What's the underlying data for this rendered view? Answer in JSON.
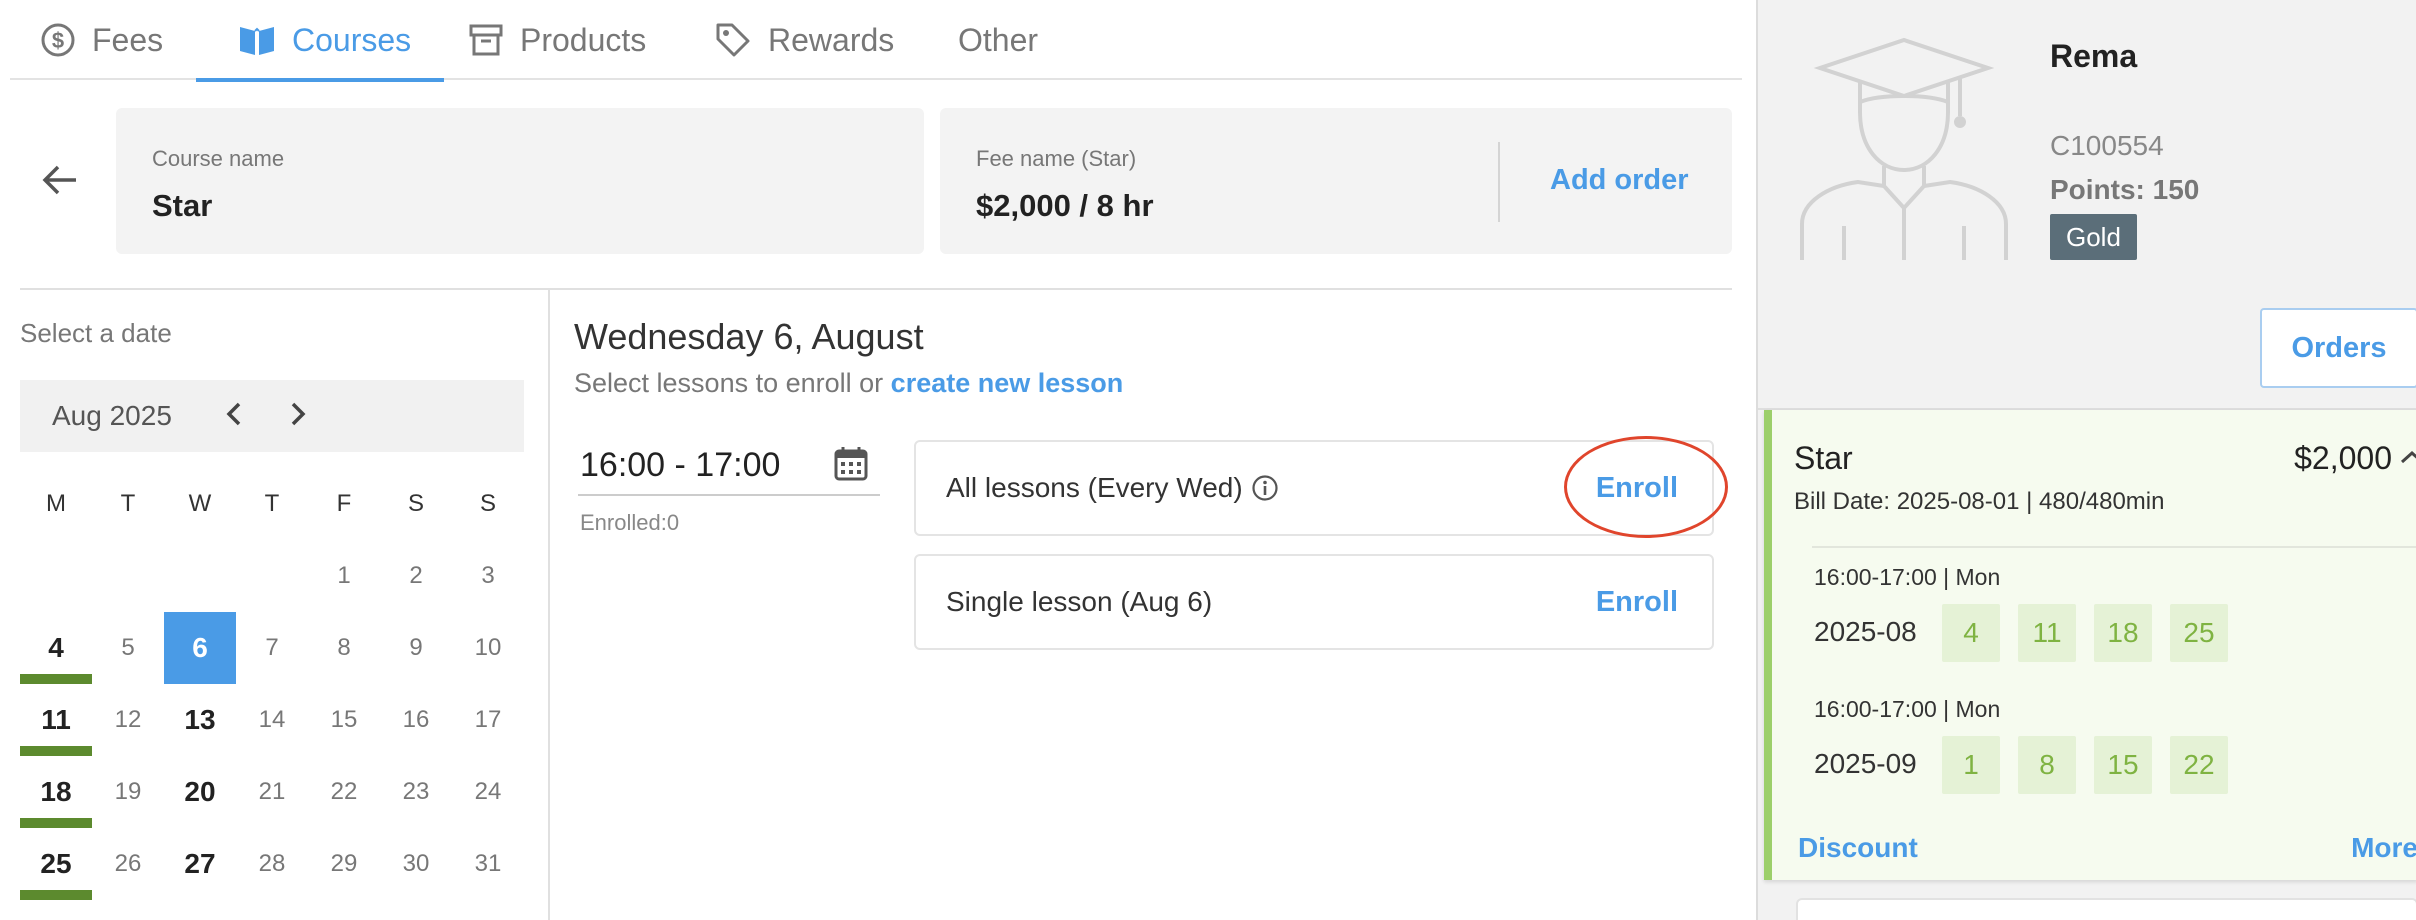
{
  "tabs": [
    {
      "label": "Fees",
      "icon": "dollar-circle-icon"
    },
    {
      "label": "Courses",
      "icon": "open-book-icon"
    },
    {
      "label": "Products",
      "icon": "archive-box-icon"
    },
    {
      "label": "Rewards",
      "icon": "tag-icon"
    },
    {
      "label": "Other",
      "icon": ""
    }
  ],
  "active_tab": "Courses",
  "accent_color": "#4a9be6",
  "course_card": {
    "label": "Course name",
    "value": "Star"
  },
  "fee_card": {
    "label": "Fee name (Star)",
    "value": "$2,000 / 8 hr",
    "action": "Add order"
  },
  "calendar": {
    "prompt": "Select a date",
    "month_label": "Aug 2025",
    "weekdays": [
      "M",
      "T",
      "W",
      "T",
      "F",
      "S",
      "S"
    ],
    "weeks": [
      [
        "",
        "",
        "",
        "1",
        "2",
        "3"
      ],
      [
        "4",
        "5",
        "6",
        "7",
        "8",
        "9",
        "10"
      ],
      [
        "11",
        "12",
        "13",
        "14",
        "15",
        "16",
        "17"
      ],
      [
        "18",
        "19",
        "20",
        "21",
        "22",
        "23",
        "24"
      ],
      [
        "25",
        "26",
        "27",
        "28",
        "29",
        "30",
        "31"
      ]
    ],
    "selected_day": "6"
  },
  "lessons": {
    "day_heading": "Wednesday 6, August",
    "subtitle_prefix": "Select lessons to enroll or",
    "create_link": "create new lesson",
    "time_range": "16:00 - 17:00",
    "enrolled": "Enrolled:0",
    "options": [
      {
        "name": "All lessons (Every Wed)",
        "action": "Enroll"
      },
      {
        "name": "Single lesson (Aug 6)",
        "action": "Enroll"
      }
    ]
  },
  "student": {
    "name": "Rema",
    "id": "C100554",
    "points": "Points: 150",
    "tier": "Gold",
    "tier_color": "#5b6e79",
    "orders_label": "Orders"
  },
  "order": {
    "course": "Star",
    "price": "$2,000",
    "bill": "Bill Date: 2025-08-01 | 480/480min",
    "schedules": [
      {
        "time": "16:00-17:00 | Mon",
        "month": "2025-08",
        "days": [
          "4",
          "11",
          "18",
          "25"
        ]
      },
      {
        "time": "16:00-17:00 | Mon",
        "month": "2025-09",
        "days": [
          "1",
          "8",
          "15",
          "22"
        ]
      }
    ],
    "discount_label": "Discount",
    "more_label": "More",
    "accent_green": "#9ccf6a"
  }
}
